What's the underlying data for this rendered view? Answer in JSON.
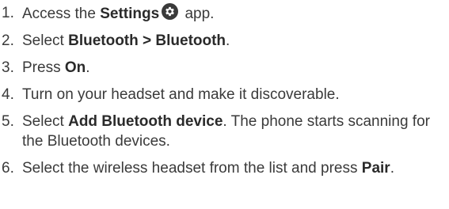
{
  "steps": [
    {
      "number": "1.",
      "pre": "Access the ",
      "bold": "Settings",
      "icon": "settings-gear-icon",
      "post": " app."
    },
    {
      "number": "2.",
      "pre": "Select ",
      "bold": "Bluetooth > Bluetooth",
      "post": "."
    },
    {
      "number": "3.",
      "pre": "Press ",
      "bold": "On",
      "post": "."
    },
    {
      "number": "4.",
      "text": "Turn on your headset and make it discoverable."
    },
    {
      "number": "5.",
      "pre": "Select ",
      "bold": "Add Bluetooth device",
      "post": ". The phone starts scanning for the Bluetooth devices."
    },
    {
      "number": "6.",
      "pre": "Select the wireless headset from the list and press ",
      "bold": "Pair",
      "post": "."
    }
  ]
}
